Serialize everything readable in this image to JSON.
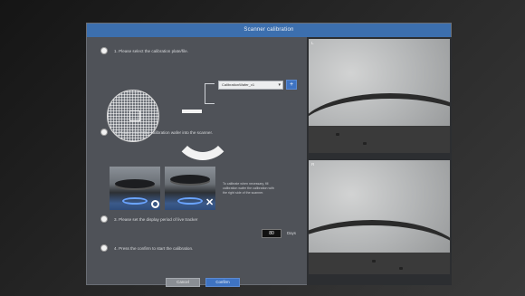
{
  "dialog": {
    "title": "Scanner calibration",
    "steps": [
      {
        "label": "1. Please select the calibration plate/file."
      },
      {
        "label": "2. Please insert the calibration wafer into the scanner."
      },
      {
        "label": "3. Please set the display period of live tracker"
      },
      {
        "label": "4. Press the confirm to start the calibration."
      }
    ],
    "calibration_select": {
      "value": "CalibrationWafer_v1",
      "add_label": "+"
    },
    "note": "To calibrate when necessary, fill calibration wafer the calibration with the right side of the scanner.",
    "display_period": {
      "value": "80",
      "unit": "Days"
    },
    "buttons": {
      "cancel": "Cancel",
      "confirm": "Confirm"
    }
  },
  "cameras": [
    {
      "label": "L"
    },
    {
      "label": "R"
    }
  ],
  "colors": {
    "accent": "#3c6fae",
    "dialog_bg": "#4f5258"
  },
  "icons": {
    "ok": "circle-ok-icon",
    "fail": "x-mark-icon"
  }
}
